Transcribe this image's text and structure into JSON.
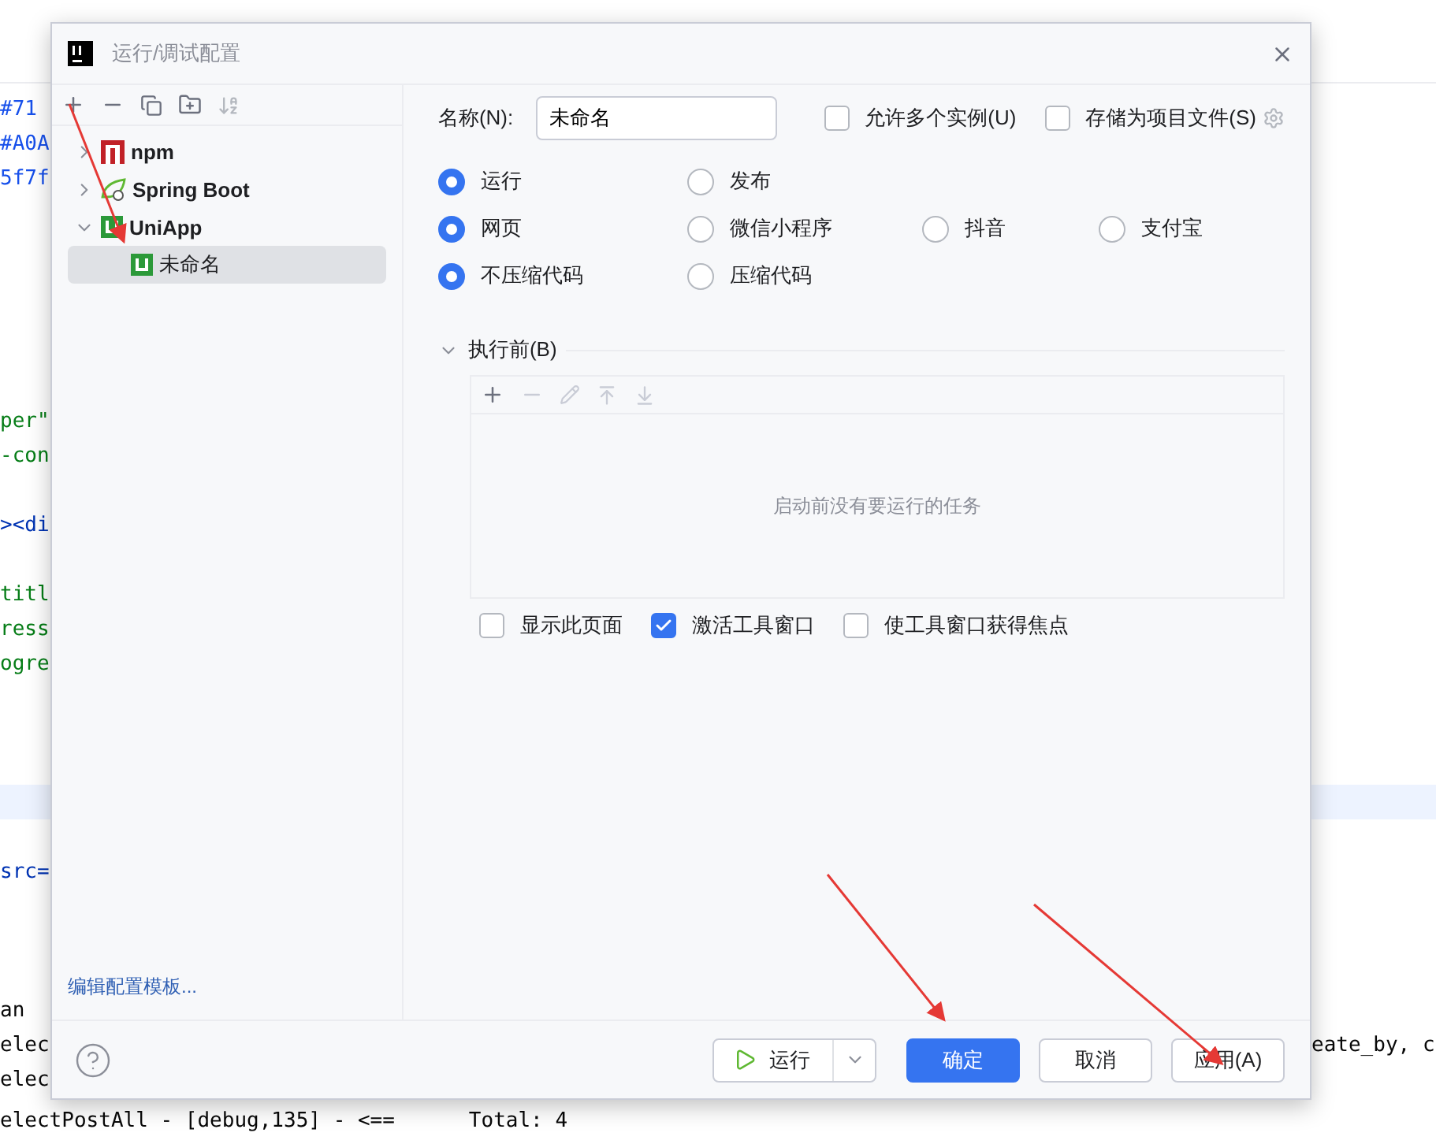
{
  "editor": {
    "left_lines": [
      {
        "text": "#71",
        "kind": "value"
      },
      {
        "text": "#A0A",
        "kind": "value"
      },
      {
        "text": "5f7f",
        "kind": "value"
      },
      {
        "text": "per\"",
        "kind": "string"
      },
      {
        "text": "-con",
        "kind": "string"
      },
      {
        "text": "><di",
        "kind": "tag"
      },
      {
        "text": "titl",
        "kind": "string"
      },
      {
        "text": "ress",
        "kind": "string"
      },
      {
        "text": "ogre",
        "kind": "string"
      },
      {
        "text": "src=",
        "kind": "tag"
      },
      {
        "text": "an",
        "kind": "plain"
      },
      {
        "text": "elec",
        "kind": "plain"
      },
      {
        "text": "elec",
        "kind": "plain"
      },
      {
        "text": "electPostAll - [debug,135] - <==      Total: 4",
        "kind": "plain"
      }
    ],
    "right_fragment": "eate_by, c"
  },
  "dialog": {
    "title": "运行/调试配置",
    "tree": [
      {
        "label": "npm",
        "kind": "npm",
        "expanded": false,
        "selected": false
      },
      {
        "label": "Spring Boot",
        "kind": "spring",
        "expanded": false,
        "selected": false
      },
      {
        "label": "UniApp",
        "kind": "uniapp",
        "expanded": true,
        "selected": false,
        "children": [
          {
            "label": "未命名",
            "kind": "uniapp",
            "selected": true
          }
        ]
      }
    ],
    "edit_templates_link": "编辑配置模板...",
    "name_label": "名称(N):",
    "name_value": "未命名",
    "top_checkboxes": [
      {
        "label": "允许多个实例(U)",
        "checked": false
      },
      {
        "label": "存储为项目文件(S)",
        "checked": false
      }
    ],
    "radio_rows": [
      [
        {
          "label": "运行",
          "selected": true
        },
        {
          "label": "发布",
          "selected": false
        }
      ],
      [
        {
          "label": "网页",
          "selected": true
        },
        {
          "label": "微信小程序",
          "selected": false
        },
        {
          "label": "抖音",
          "selected": false
        },
        {
          "label": "支付宝",
          "selected": false
        }
      ],
      [
        {
          "label": "不压缩代码",
          "selected": true
        },
        {
          "label": "压缩代码",
          "selected": false
        }
      ]
    ],
    "before_launch": {
      "title": "执行前(B)",
      "expanded": true,
      "empty_text": "启动前没有要运行的任务"
    },
    "bottom_checkboxes": [
      {
        "label": "显示此页面",
        "checked": false
      },
      {
        "label": "激活工具窗口",
        "checked": true
      },
      {
        "label": "使工具窗口获得焦点",
        "checked": false
      }
    ],
    "run_button": "运行",
    "ok_button": "确定",
    "cancel_button": "取消",
    "apply_button": "应用(A)"
  }
}
